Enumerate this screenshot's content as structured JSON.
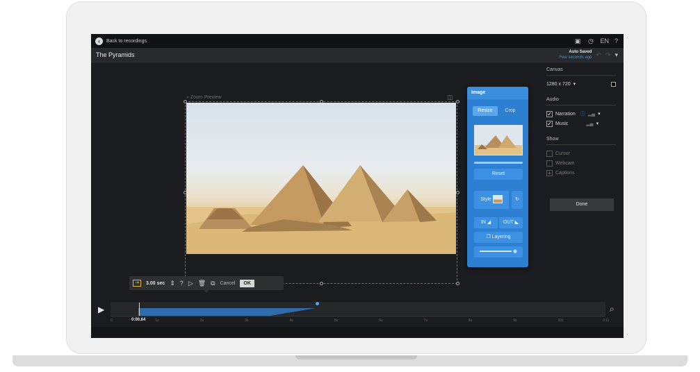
{
  "topbar": {
    "back_label": "Back to recordings",
    "icons": [
      "monitor-icon",
      "history-icon",
      "help-icon"
    ],
    "language": "EN",
    "help": "?"
  },
  "titlebar": {
    "title": "The Pyramids",
    "autosave_status": "Auto Saved",
    "autosave_time": "Few seconds ago"
  },
  "canvas": {
    "zoom_label": "Zoom Preview"
  },
  "image_panel": {
    "title": "Image",
    "tabs": [
      "Resize",
      "Crop"
    ],
    "active_tab": "Resize",
    "reset_label": "Reset",
    "style_label": "Style",
    "in_label": "IN",
    "out_label": "OUT",
    "layering_label": "Layering"
  },
  "sidebar": {
    "canvas_heading": "Canvas",
    "canvas_size": "1280 x 720",
    "audio_heading": "Audio",
    "audio_items": [
      {
        "label": "Narration",
        "checked": true
      },
      {
        "label": "Music",
        "checked": true
      }
    ],
    "show_heading": "Show",
    "show_items": [
      {
        "label": "Cursor",
        "checked": false
      },
      {
        "label": "Webcam",
        "checked": false
      },
      {
        "label": "Captions",
        "checked": false
      }
    ],
    "done_label": "Done"
  },
  "clip_toolbar": {
    "duration": "3.00 sec",
    "cancel_label": "Cancel",
    "ok_label": "OK"
  },
  "timeline": {
    "current_time": "0:00.64",
    "ticks": [
      "0",
      "1s",
      "2s",
      "3s",
      "4s",
      "5s",
      "6s",
      "7s",
      "8s",
      "9s",
      "10s",
      "0:11"
    ]
  },
  "colors": {
    "accent": "#2c7fd1",
    "background": "#1b1c1f"
  }
}
